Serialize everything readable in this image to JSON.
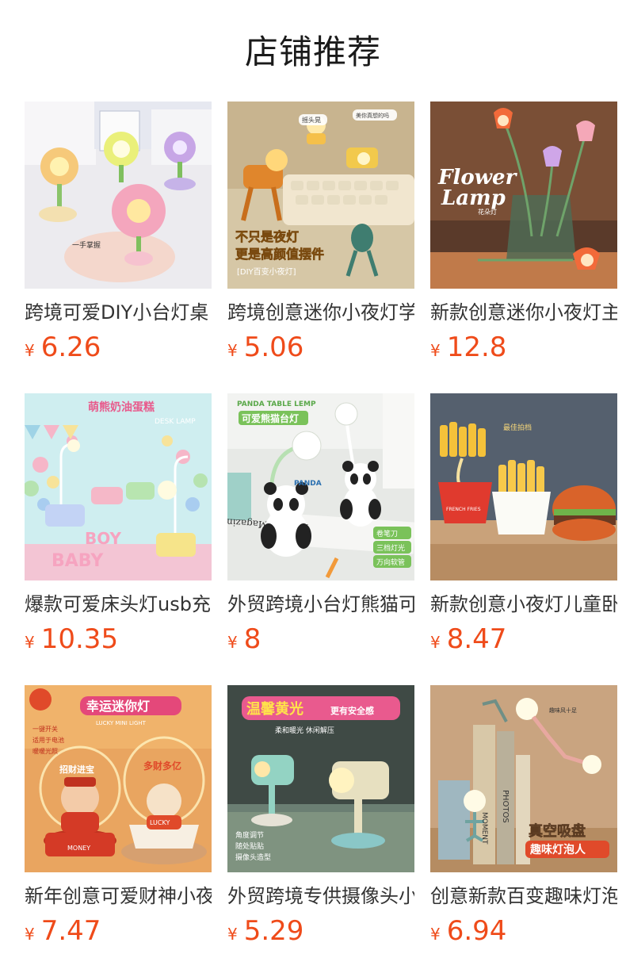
{
  "header": {
    "title": "店铺推荐"
  },
  "products": [
    {
      "name": "跨境可爱DIY小台灯桌",
      "currency": "¥",
      "price": "6.26",
      "image": "flower-lamp-image",
      "overlay": [
        "一手掌握"
      ]
    },
    {
      "name": "跨境创意迷你小夜灯学",
      "currency": "¥",
      "price": "5.06",
      "image": "deer-lamp-image",
      "overlay": [
        "不只是夜灯",
        "更是高颜值摆件",
        "[DIY百变小夜灯]",
        "摇头晃",
        "美你真想的吗"
      ]
    },
    {
      "name": "新款创意迷你小夜灯主",
      "currency": "¥",
      "price": "12.8",
      "image": "tulip-lamp-image",
      "overlay": [
        "Flower",
        "Lamp",
        "花朵灯"
      ]
    },
    {
      "name": "爆款可爱床头灯usb充",
      "currency": "¥",
      "price": "10.35",
      "image": "cake-lamp-image",
      "overlay": [
        "萌熊奶油蛋糕",
        "DESK LAMP",
        "BOY",
        "BABY"
      ]
    },
    {
      "name": "外贸跨境小台灯熊猫可",
      "currency": "¥",
      "price": "8",
      "image": "panda-lamp-image",
      "overlay": [
        "PANDA TABLE LEMP",
        "可爱熊猫台灯",
        "PANDA",
        "Fashion Magazine",
        "卷笔刀",
        "三档灯光",
        "万向软管"
      ]
    },
    {
      "name": "新款创意小夜灯儿童卧",
      "currency": "¥",
      "price": "8.47",
      "image": "fries-lamp-image",
      "overlay": [
        "最佳拍档",
        "FRENCH FRIES"
      ]
    },
    {
      "name": "新年创意可爱财神小夜",
      "currency": "¥",
      "price": "7.47",
      "image": "lucky-lamp-image",
      "overlay": [
        "幸运迷你灯",
        "LUCKY MINI LIGHT",
        "一键开关",
        "适用于电池",
        "暖暖光照",
        "招财进宝",
        "多财多亿",
        "MONEY",
        "LUCKY"
      ]
    },
    {
      "name": "外贸跨境专供摄像头小",
      "currency": "¥",
      "price": "5.29",
      "image": "camera-lamp-image",
      "overlay": [
        "温馨黄光",
        "更有安全感",
        "柔和暖光 休闲解压",
        "角度调节",
        "随处贴贴",
        "摄像头造型"
      ]
    },
    {
      "name": "创意新款百变趣味灯泡",
      "currency": "¥",
      "price": "6.94",
      "image": "bulb-man-lamp-image",
      "overlay": [
        "趣味风十足",
        "真空吸盘",
        "趣味灯泡人",
        "PHOTOS",
        "MOMENT"
      ]
    }
  ],
  "colors": {
    "price": "#ef4b1a",
    "title": "#1a1a1a",
    "name": "#333333"
  }
}
